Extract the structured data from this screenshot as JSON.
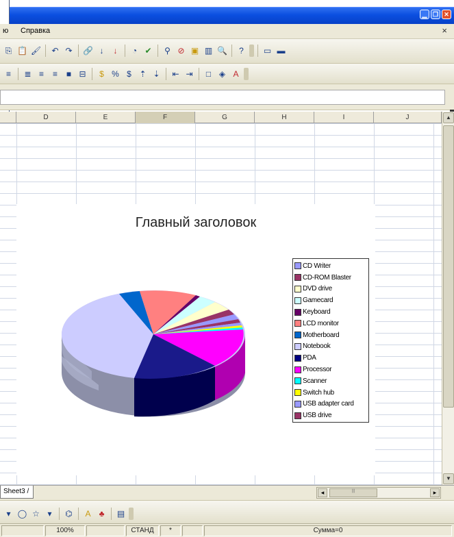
{
  "menubar": {
    "partial_item": "ю",
    "help_label": "Справка",
    "close_doc_glyph": "×"
  },
  "columns": [
    "D",
    "E",
    "F",
    "G",
    "H",
    "I",
    "J"
  ],
  "selected_column": "F",
  "chart": {
    "title": "Главный заголовок",
    "legend": [
      {
        "label": "CD Writer",
        "color": "#9999ff"
      },
      {
        "label": "CD-ROM Blaster",
        "color": "#993366"
      },
      {
        "label": "DVD drive",
        "color": "#ffffcc"
      },
      {
        "label": "Gamecard",
        "color": "#ccffff"
      },
      {
        "label": "Keyboard",
        "color": "#660066"
      },
      {
        "label": "LCD monitor",
        "color": "#ff8080"
      },
      {
        "label": "Motherboard",
        "color": "#0066cc"
      },
      {
        "label": "Notebook",
        "color": "#ccccff"
      },
      {
        "label": "PDA",
        "color": "#000080"
      },
      {
        "label": "Processor",
        "color": "#ff00ff"
      },
      {
        "label": "Scanner",
        "color": "#00ffff"
      },
      {
        "label": "Switch hub",
        "color": "#ffff00"
      },
      {
        "label": "USB adapter card",
        "color": "#9999ff"
      },
      {
        "label": "USB drive",
        "color": "#993366"
      }
    ]
  },
  "sheet_tab": {
    "label": "Sheet3"
  },
  "statusbar": {
    "zoom": "100%",
    "mode": "СТАНД",
    "marker": "*",
    "sum": "Сумма=0"
  }
}
